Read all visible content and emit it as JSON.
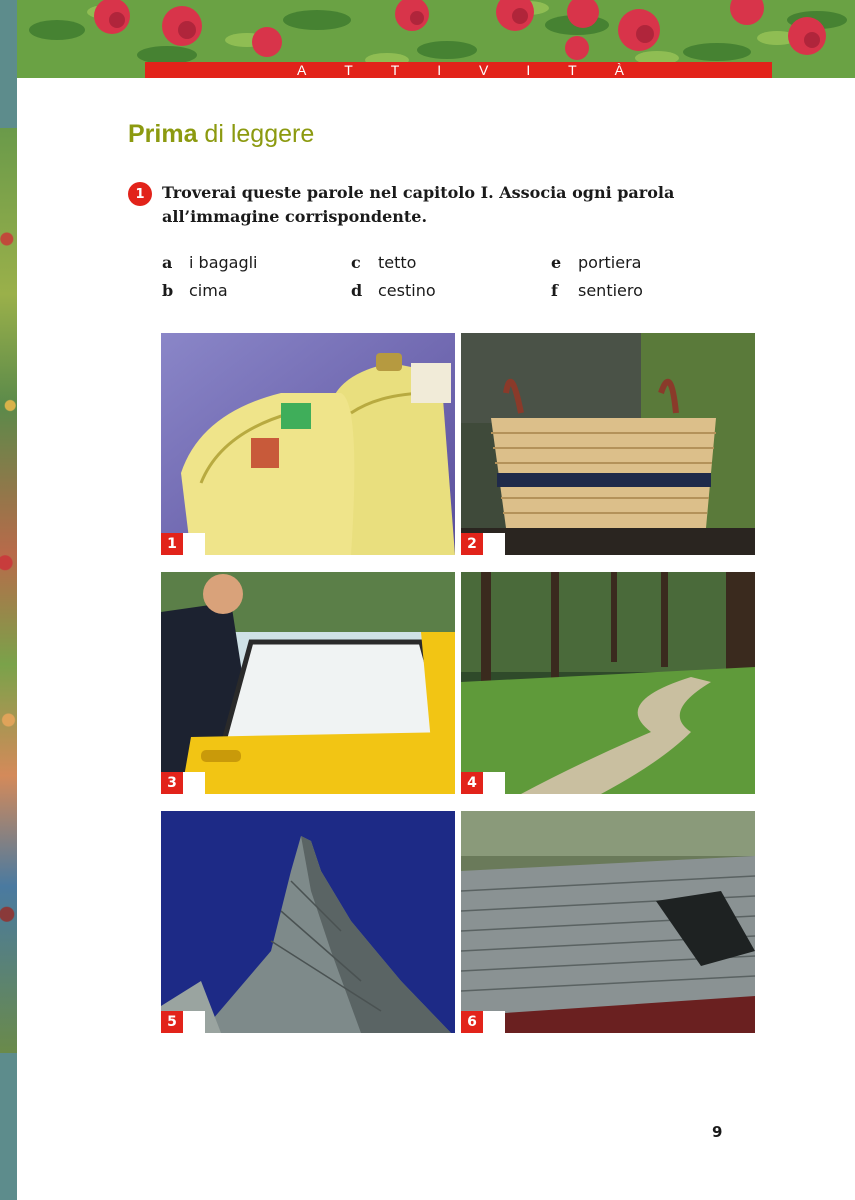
{
  "header": {
    "banner_letters": [
      "A",
      "T",
      "T",
      "I",
      "V",
      "I",
      "T",
      "À"
    ]
  },
  "section": {
    "title_bold": "Prima",
    "title_rest": " di leggere"
  },
  "exercise": {
    "number": "1",
    "instruction": "Troverai queste parole nel capitolo I. Associa ogni parola all’immagine corrispondente.",
    "words": [
      {
        "letter": "a",
        "word": "i bagagli"
      },
      {
        "letter": "b",
        "word": "cima"
      },
      {
        "letter": "c",
        "word": "tetto"
      },
      {
        "letter": "d",
        "word": "cestino"
      },
      {
        "letter": "e",
        "word": "portiera"
      },
      {
        "letter": "f",
        "word": "sentiero"
      }
    ],
    "photos": [
      {
        "number": "1",
        "icon": "suitcases-photo"
      },
      {
        "number": "2",
        "icon": "basket-photo"
      },
      {
        "number": "3",
        "icon": "car-door-photo"
      },
      {
        "number": "4",
        "icon": "forest-path-photo"
      },
      {
        "number": "5",
        "icon": "mountain-peak-photo"
      },
      {
        "number": "6",
        "icon": "slate-roof-photo"
      }
    ]
  },
  "page_number": "9",
  "colors": {
    "accent_red": "#e2231a",
    "title_olive": "#8c9a10",
    "side_band": "#5d8c8c"
  }
}
